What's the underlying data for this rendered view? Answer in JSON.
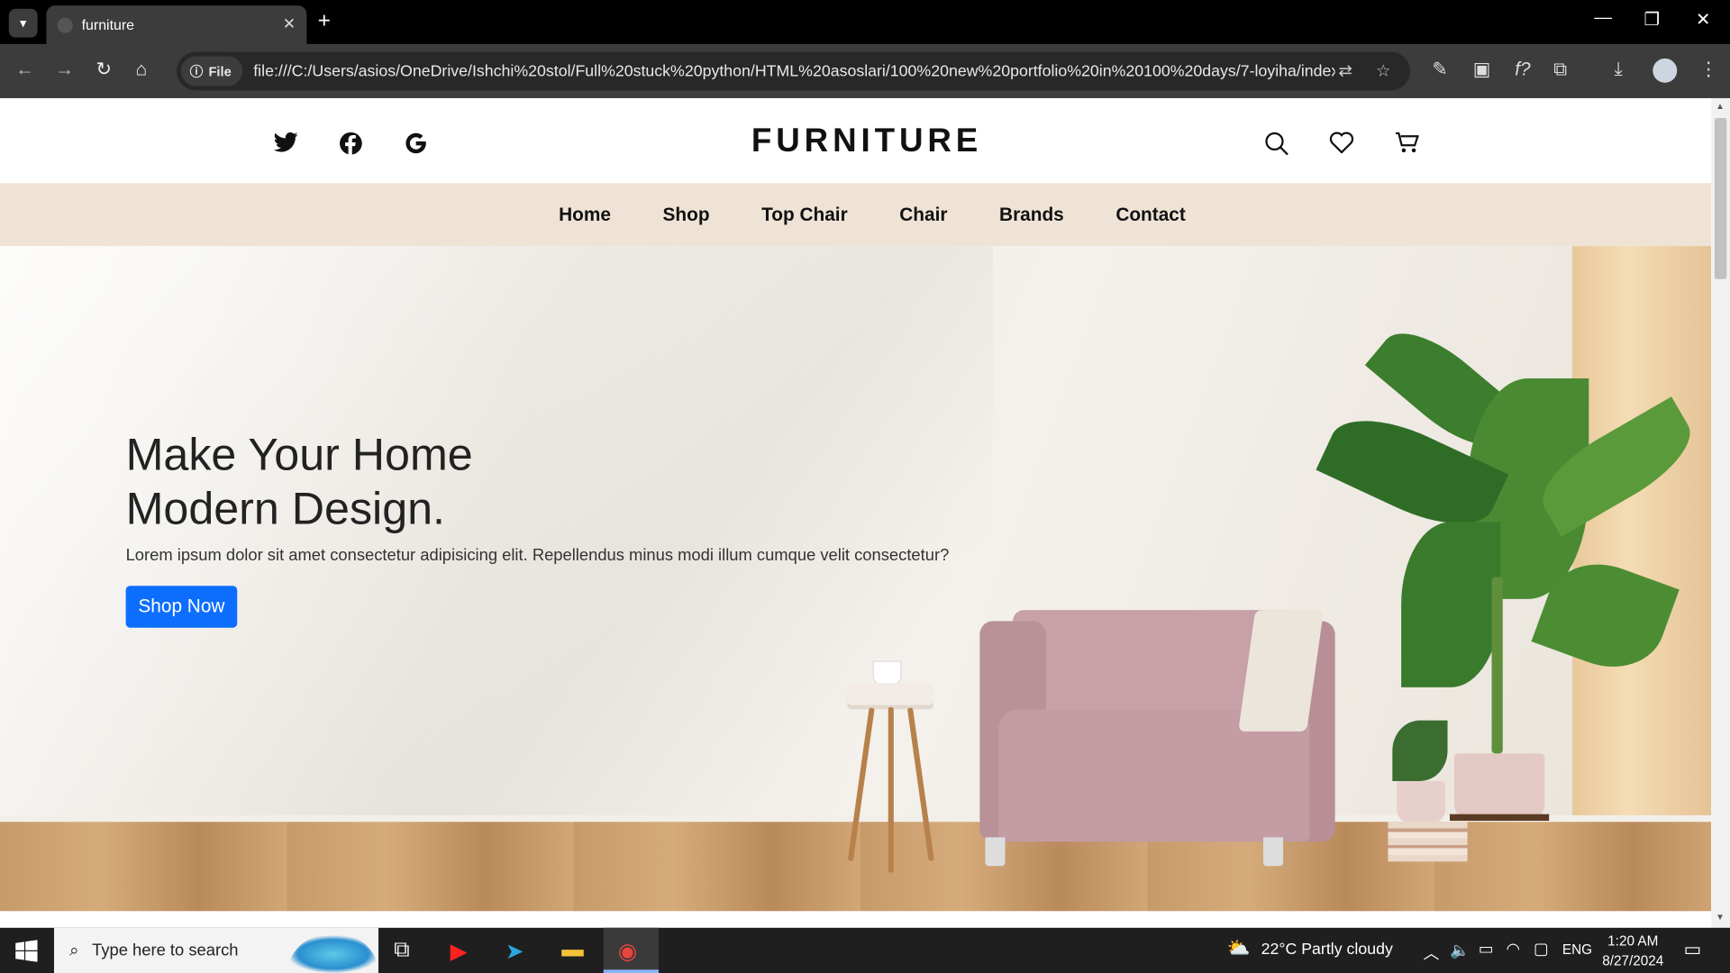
{
  "browser": {
    "tab_title": "furniture",
    "url": "file:///C:/Users/asios/OneDrive/Ishchi%20stol/Full%20stuck%20python/HTML%20asoslari/100%20new%20portfolio%20in%20100%20days/7-loyiha/index...",
    "file_chip": "File"
  },
  "header": {
    "brand": "FURNITURE",
    "social_icons": [
      "twitter-icon",
      "facebook-icon",
      "google-icon"
    ],
    "action_icons": [
      "search-icon",
      "heart-icon",
      "cart-icon"
    ]
  },
  "nav": {
    "items": [
      {
        "label": "Home"
      },
      {
        "label": "Shop"
      },
      {
        "label": "Top Chair"
      },
      {
        "label": "Chair"
      },
      {
        "label": "Brands"
      },
      {
        "label": "Contact"
      }
    ]
  },
  "hero": {
    "title_line1": "Make Your Home",
    "title_line2": "Modern Design.",
    "text": "Lorem ipsum dolor sit amet consectetur adipisicing elit. Repellendus minus modi illum cumque velit consectetur?",
    "button_label": "Shop Now",
    "button_color": "#0d6efd",
    "menu_bg": "#efe3d6"
  },
  "taskbar": {
    "search_placeholder": "Type here to search",
    "weather": "22°C  Partly cloudy",
    "language": "ENG",
    "time": "1:20 AM",
    "date": "8/27/2024"
  }
}
